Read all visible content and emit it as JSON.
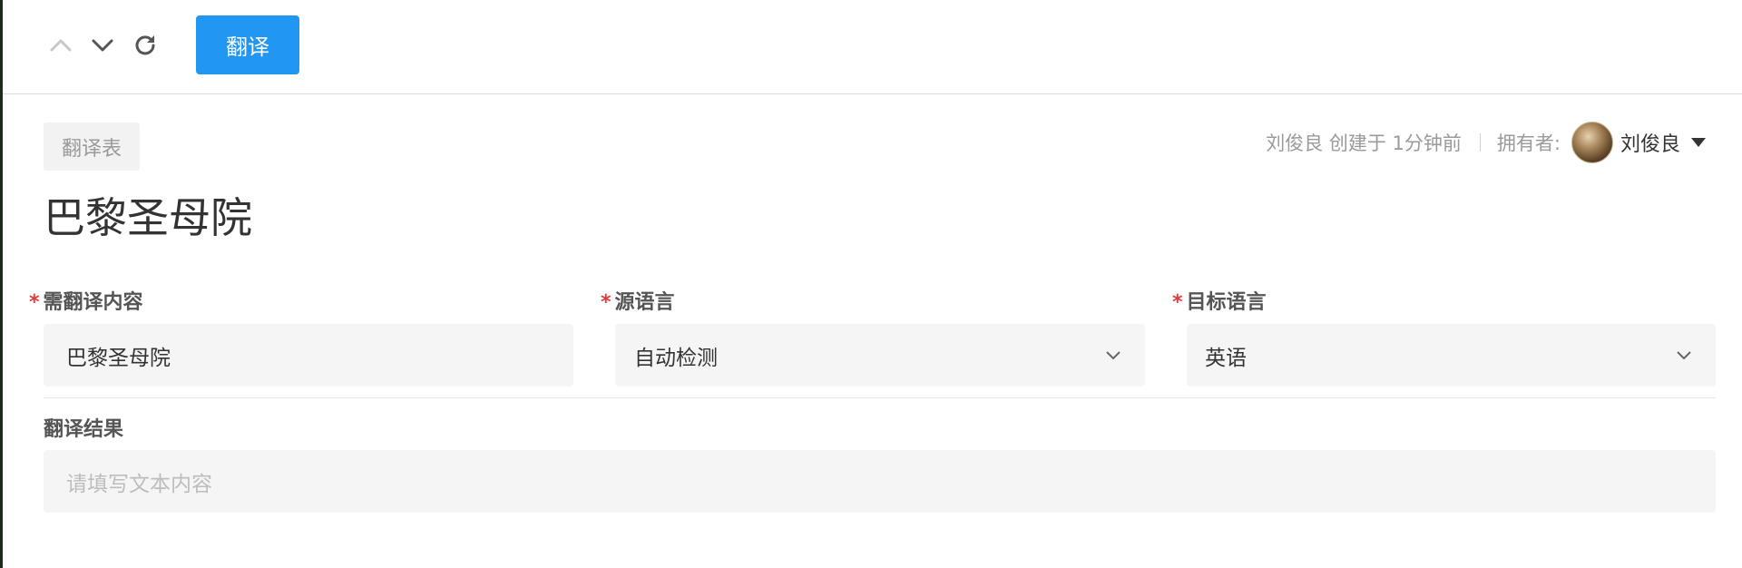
{
  "toolbar": {
    "translate_label": "翻译",
    "icons": [
      "chevron-up-icon",
      "chevron-down-icon",
      "refresh-icon"
    ]
  },
  "document": {
    "type_tag": "翻译表",
    "title": "巴黎圣母院",
    "creator_text": "刘俊良 创建于 1分钟前",
    "owner_label": "拥有者:",
    "owner_name": "刘俊良"
  },
  "fields": {
    "content": {
      "label": "需翻译内容",
      "required_mark": "*",
      "value": "巴黎圣母院"
    },
    "source_lang": {
      "label": "源语言",
      "required_mark": "*",
      "value": "自动检测"
    },
    "target_lang": {
      "label": "目标语言",
      "required_mark": "*",
      "value": "英语"
    },
    "result": {
      "label": "翻译结果",
      "placeholder": "请填写文本内容"
    }
  },
  "colors": {
    "primary": "#2196f3",
    "required": "#e53935",
    "field_bg": "#f5f5f5"
  }
}
